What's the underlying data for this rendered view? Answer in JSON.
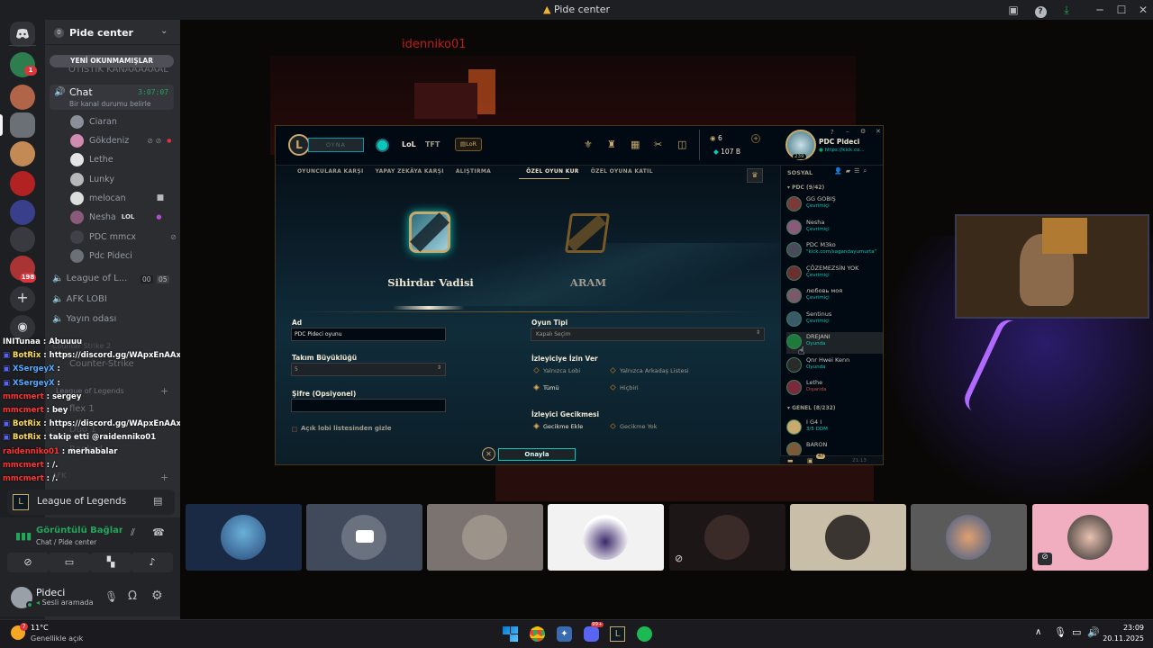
{
  "window": {
    "title": "Pide center"
  },
  "servers": {
    "badges": [
      "1",
      "198"
    ]
  },
  "channels": {
    "header": "Pide center",
    "unread_banner": "YENİ OKUNMAMIŞLAR",
    "hidden_channel": "OTİSTİK KANAAAAAAL",
    "voice_channel": "Chat",
    "voice_timer": "3:07:07",
    "voice_status": "Bir kanal durumu belirle",
    "members": [
      "Ciaran",
      "Gökdeniz",
      "Lethe",
      "Lunky",
      "melocan",
      "Nesha",
      "PDC mmcx",
      "Pdc Pideci"
    ],
    "nesha_tag": "LOL",
    "channel_list": [
      "League of L...",
      "AFK LOBİ",
      "Yayın odası"
    ],
    "league_counts": [
      "00",
      "05"
    ],
    "overlapped": [
      "Counter Strike 2",
      "Counter-Strike",
      "League of Legends",
      "flex 1",
      "Duo 1",
      "Ranked",
      "AFK"
    ]
  },
  "overlay_chat": [
    {
      "user": "INITunaa",
      "text": " : Abuuuu",
      "bot": false,
      "color": "#ffffff"
    },
    {
      "user": "BotRix",
      "text": " : https://discord.gg/WApxEnAAxu discord",
      "bot": true,
      "color": "#ffdd55"
    },
    {
      "user": "XSergeyX",
      "text": " :",
      "bot": true,
      "color": "#55aaff"
    },
    {
      "user": "XSergeyX",
      "text": " :",
      "bot": true,
      "color": "#55aaff"
    },
    {
      "user": "mmcmert",
      "text": " : sergey",
      "bot": false,
      "color": "#ff3333"
    },
    {
      "user": "mmcmert",
      "text": " : bey",
      "bot": false,
      "color": "#ff3333"
    },
    {
      "user": "BotRix",
      "text": " : https://discord.gg/WApxEnAAxu discord",
      "bot": true,
      "color": "#ffdd55"
    },
    {
      "user": "BotRix",
      "text": " : takip etti @raidenniko01",
      "bot": true,
      "color": "#ffdd55"
    },
    {
      "user": "raidenniko01",
      "text": " : merhabalar",
      "bot": false,
      "color": "#ff3333"
    },
    {
      "user": "mmcmert",
      "text": " : /.",
      "bot": false,
      "color": "#ff3333"
    },
    {
      "user": "mmcmert",
      "text": " : /.",
      "bot": false,
      "color": "#ff3333"
    }
  ],
  "activity": {
    "game": "League of Legends"
  },
  "voice_panel": {
    "status": "Görüntülü Bağlantı K",
    "channel": "Chat / Pide center"
  },
  "user_panel": {
    "name": "Pideci",
    "status": "Sesli aramada"
  },
  "stream": {
    "streamer_name": "idenniko01"
  },
  "lol": {
    "play_button": "OYNA",
    "nav_lol": "LoL",
    "nav_tft": "TFT",
    "nav_lor": "LoR",
    "currency_rp": "6",
    "currency_be": "107 B",
    "profile_name": "PDC Pideci",
    "profile_status": "https://kick.co...",
    "level": "239",
    "tabs": [
      "OYUNCULARA KARŞI",
      "YAPAY ZEKÂYA KARŞI",
      "ALIŞTIRMA",
      "ÖZEL OYUN KUR",
      "ÖZEL OYUNA KATIL"
    ],
    "maps": [
      {
        "name": "Sihirdar Vadisi"
      },
      {
        "name": "ARAM"
      }
    ],
    "form": {
      "name_label": "Ad",
      "name_value": "PDC Pideci oyunu",
      "team_label": "Takım Büyüklüğü",
      "team_value": "5",
      "password_label": "Şifre (Opsiyonel)",
      "hide_label": "Açık lobi listesinden gizle",
      "game_type_label": "Oyun Tipi",
      "game_type_value": "Kapalı Seçim",
      "spectate_label": "İzleyiciye İzin Ver",
      "spectate_options": [
        "Yalnızca Lobi",
        "Yalnızca Arkadaş Listesi",
        "Tümü",
        "Hiçbiri"
      ],
      "delay_label": "İzleyici Gecikmesi",
      "delay_options": [
        "Gecikme Ekle",
        "Gecikme Yok"
      ],
      "confirm": "Onayla"
    },
    "social": {
      "header": "SOSYAL",
      "group1": "PDC (9/42)",
      "group2": "GENEL (8/232)",
      "friends": [
        {
          "name": "GG GOBIŞ",
          "status": "Çevrimiçi"
        },
        {
          "name": "Nesha",
          "status": "Çevrimiçi"
        },
        {
          "name": "PDC M3ko",
          "status": "\"kick.com/sagandayumurta\""
        },
        {
          "name": "ÇÖZEMEZSİN YOK",
          "status": "Çevrimiçi"
        },
        {
          "name": "любовь моя",
          "status": "Çevrimiçi"
        },
        {
          "name": "Sentinus",
          "status": "Çevrimiçi"
        },
        {
          "name": "DREJANI",
          "status": "Oyunda"
        },
        {
          "name": "Qnr Hwei Kenn",
          "status": "Oyunda"
        },
        {
          "name": "Lethe",
          "status": "Dışarıda"
        }
      ],
      "general": [
        {
          "name": "I G4 I",
          "status": "3/5 DDM"
        },
        {
          "name": "BARON",
          "status": ""
        }
      ],
      "footer_time": "21:13",
      "footer_badge": "47"
    }
  },
  "taskbar": {
    "temp": "11°C",
    "weather": "Genellikle açık",
    "time": "23:09",
    "date": "20.11.2025",
    "discord_badge": "99+"
  }
}
